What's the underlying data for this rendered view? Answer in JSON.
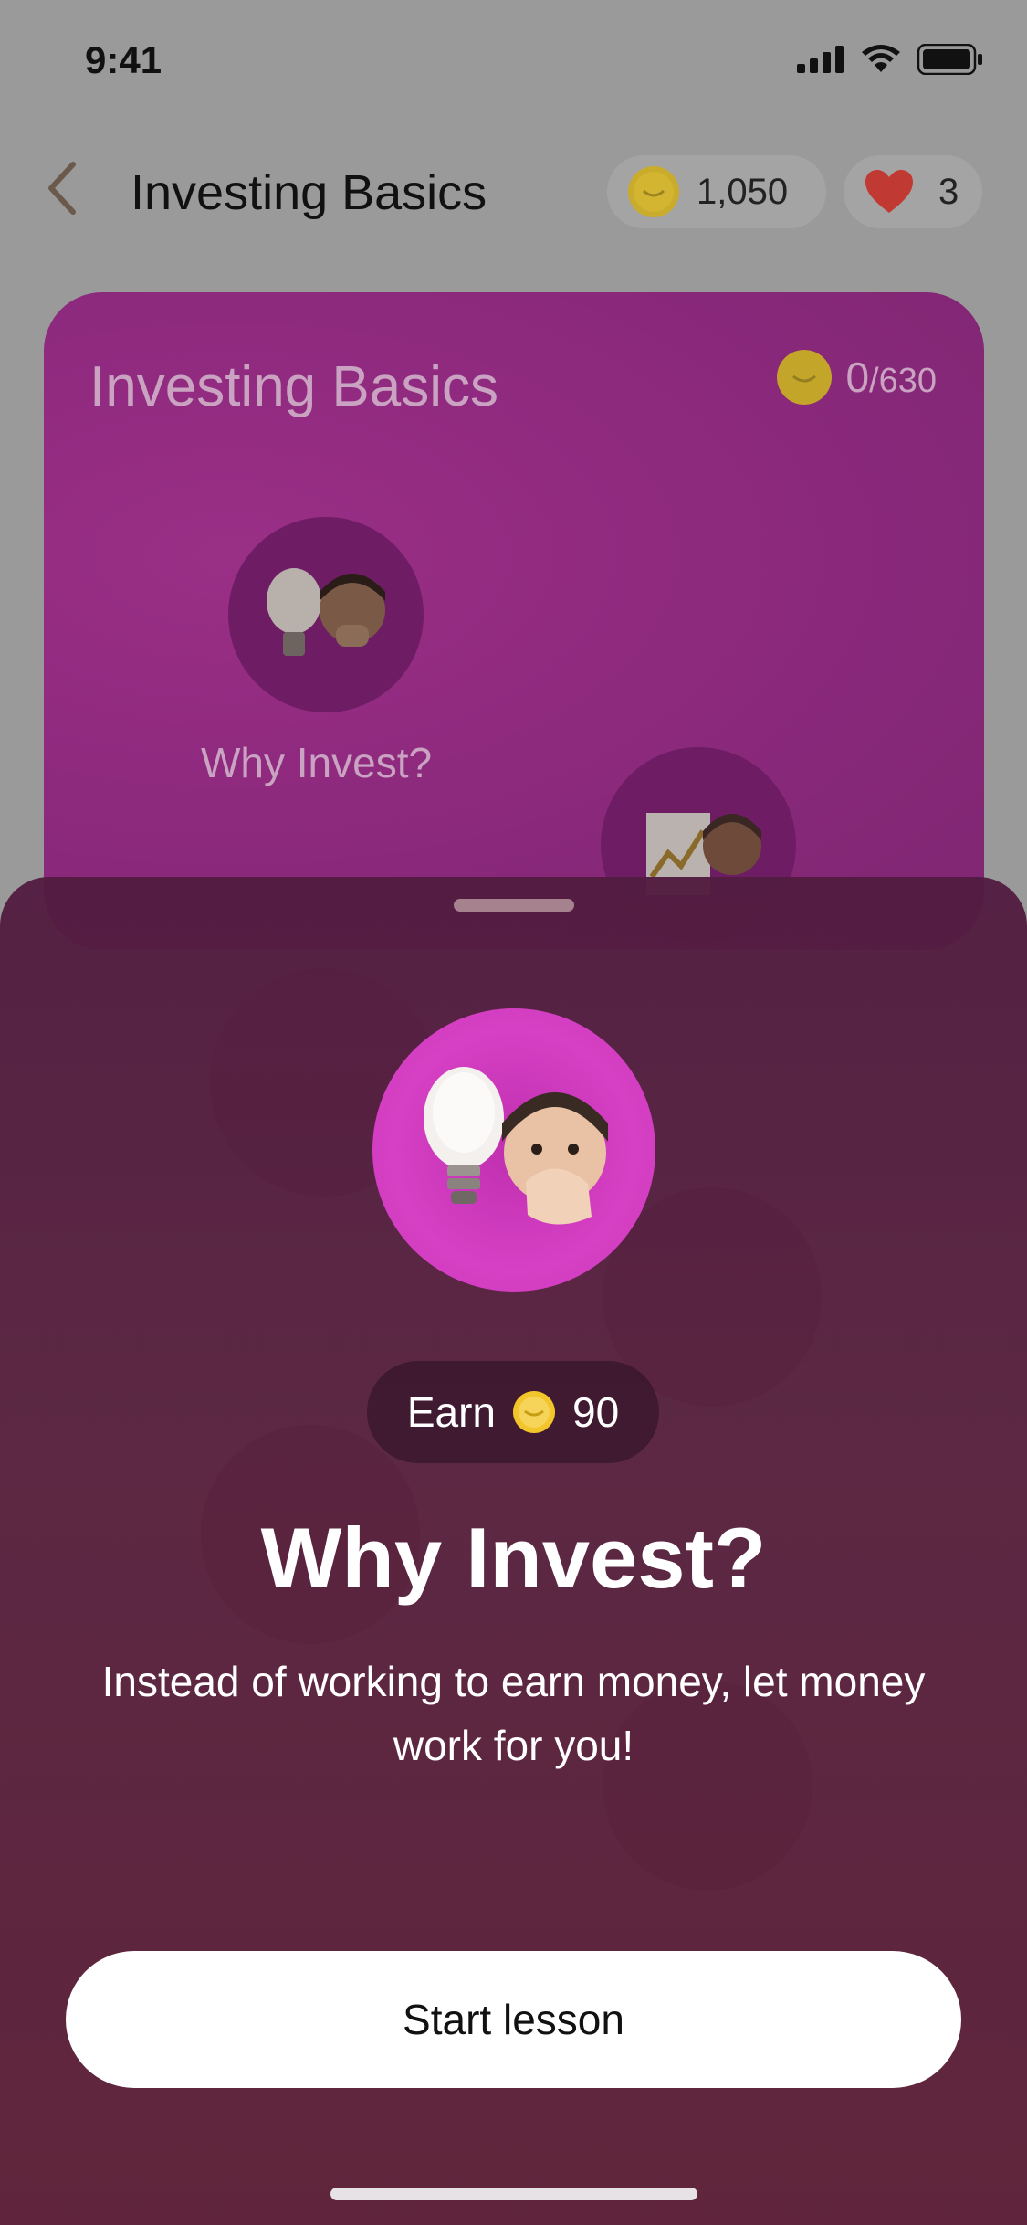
{
  "status_bar": {
    "time": "9:41"
  },
  "header": {
    "title": "Investing Basics",
    "coins": "1,050",
    "lives": "3"
  },
  "card": {
    "title": "Investing Basics",
    "coins_earned": "0",
    "coins_total": "/630",
    "lessons": [
      {
        "label": "Why Invest?"
      }
    ]
  },
  "sheet": {
    "earn_label": "Earn",
    "earn_amount": "90",
    "title": "Why Invest?",
    "description": "Instead of working to earn money, let money work for you!",
    "start_button": "Start lesson"
  },
  "colors": {
    "card_purple": "#8f2a7f",
    "sheet_dark": "#521c40",
    "hero_pink": "#d640c4",
    "coin_yellow": "#f2c62b",
    "heart_red": "#e53935"
  },
  "icons": [
    "back-chevron-icon",
    "coin-icon",
    "heart-icon",
    "signal-icon",
    "wifi-icon",
    "battery-icon",
    "lightbulb-icon",
    "face-icon",
    "chart-icon"
  ]
}
